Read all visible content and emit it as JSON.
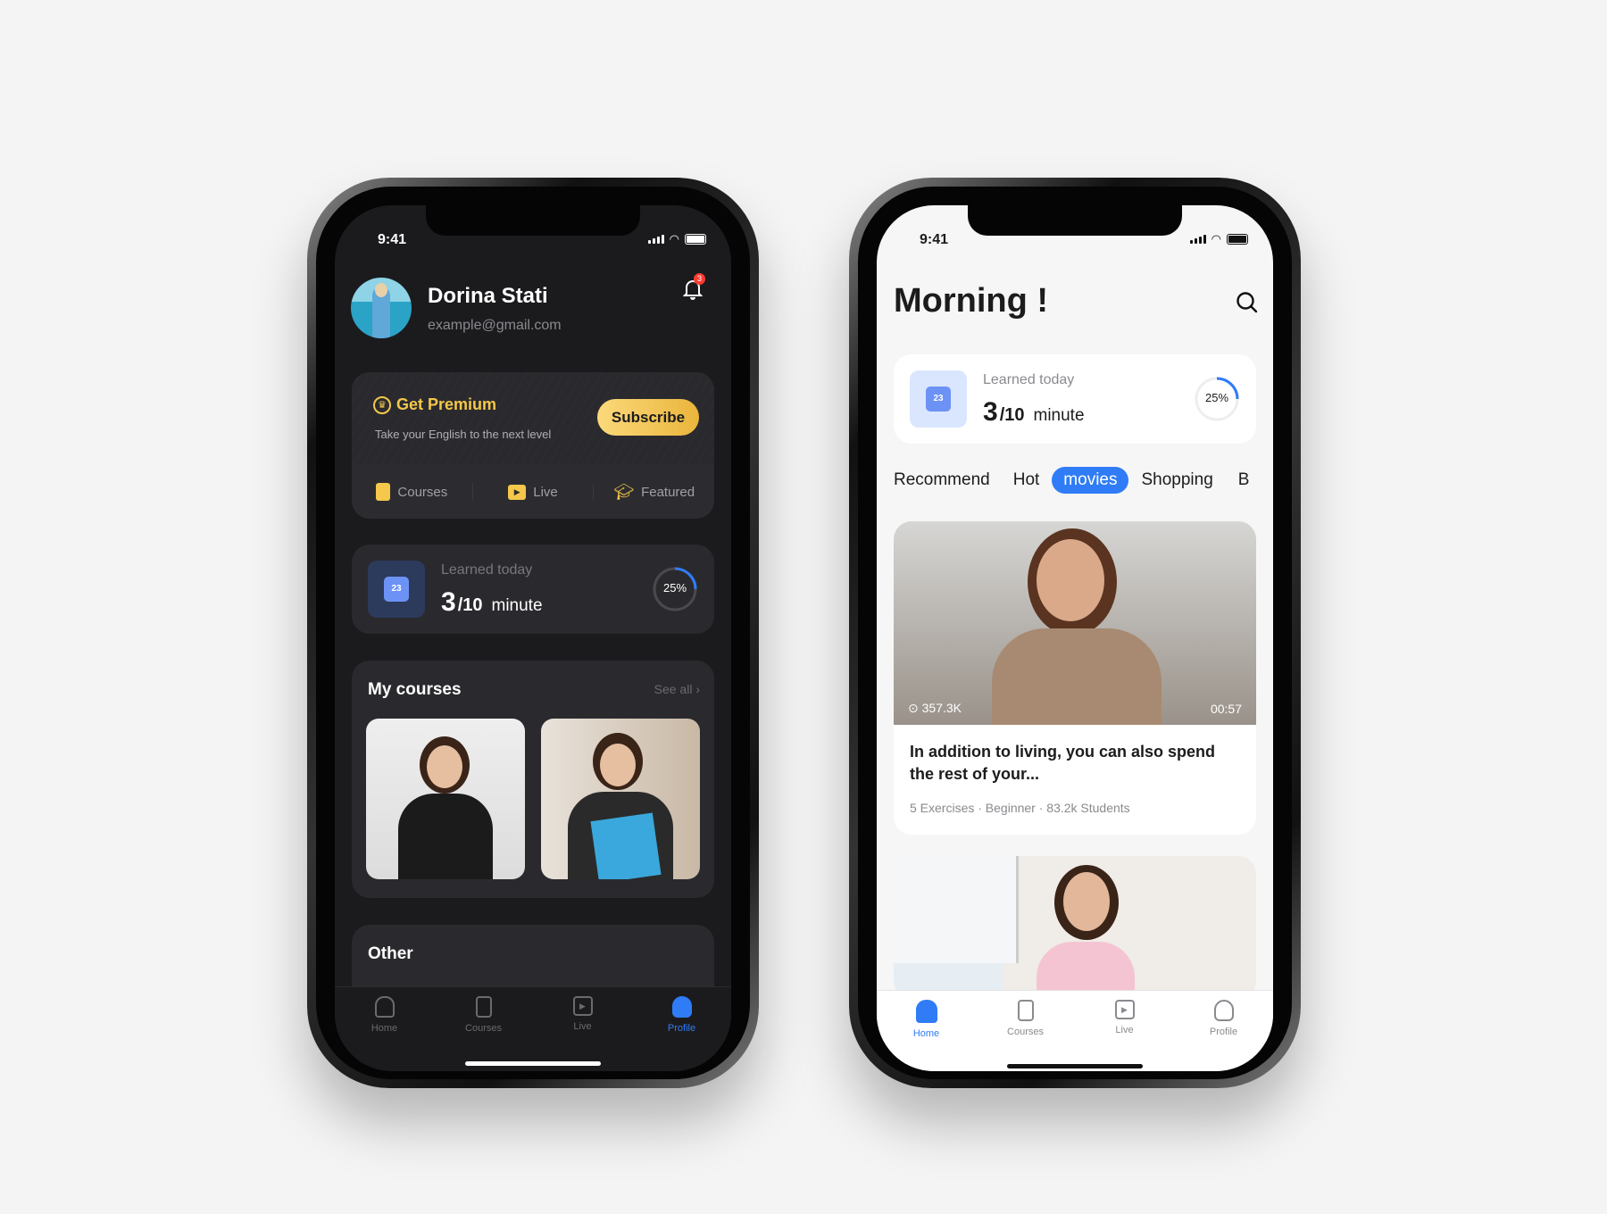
{
  "status_bar": {
    "time": "9:41"
  },
  "dark_screen": {
    "profile": {
      "name": "Dorina Stati",
      "email": "example@gmail.com",
      "notification_count": "3"
    },
    "premium": {
      "title": "Get Premium",
      "subtitle": "Take your English to the next level",
      "subscribe_label": "Subscribe",
      "shortcuts": [
        {
          "label": "Courses",
          "icon": "courses-icon"
        },
        {
          "label": "Live",
          "icon": "live-tv-icon"
        },
        {
          "label": "Featured",
          "icon": "graduation-cap-icon"
        }
      ]
    },
    "learned": {
      "label": "Learned today",
      "value": "3",
      "total": "/10",
      "unit": "minute",
      "percent_label": "25%",
      "percent": 25,
      "calendar_day": "23"
    },
    "my_courses": {
      "title": "My courses",
      "see_all": "See all"
    },
    "other": {
      "title": "Other"
    },
    "tabbar": [
      {
        "label": "Home"
      },
      {
        "label": "Courses"
      },
      {
        "label": "Live"
      },
      {
        "label": "Profile",
        "active": true
      }
    ]
  },
  "light_screen": {
    "greeting": "Morning !",
    "learned": {
      "label": "Learned today",
      "value": "3",
      "total": "/10",
      "unit": "minute",
      "percent_label": "25%",
      "percent": 25,
      "calendar_day": "23"
    },
    "categories": [
      {
        "label": "Recommend"
      },
      {
        "label": "Hot"
      },
      {
        "label": "movies",
        "active": true
      },
      {
        "label": "Shopping"
      },
      {
        "label": "B"
      }
    ],
    "video": {
      "views": "357.3K",
      "duration": "00:57",
      "title": "In addition to living, you can also spend the rest of your...",
      "meta": "5 Exercises · Beginner · 83.2k Students"
    },
    "tabbar": [
      {
        "label": "Home",
        "active": true
      },
      {
        "label": "Courses"
      },
      {
        "label": "Live"
      },
      {
        "label": "Profile"
      }
    ]
  },
  "colors": {
    "accent_blue": "#2f7cf6",
    "gold": "#f5c74a",
    "dark_bg": "#1b1b1e",
    "dark_card": "#2a2a2e",
    "badge_red": "#ff3b30"
  }
}
